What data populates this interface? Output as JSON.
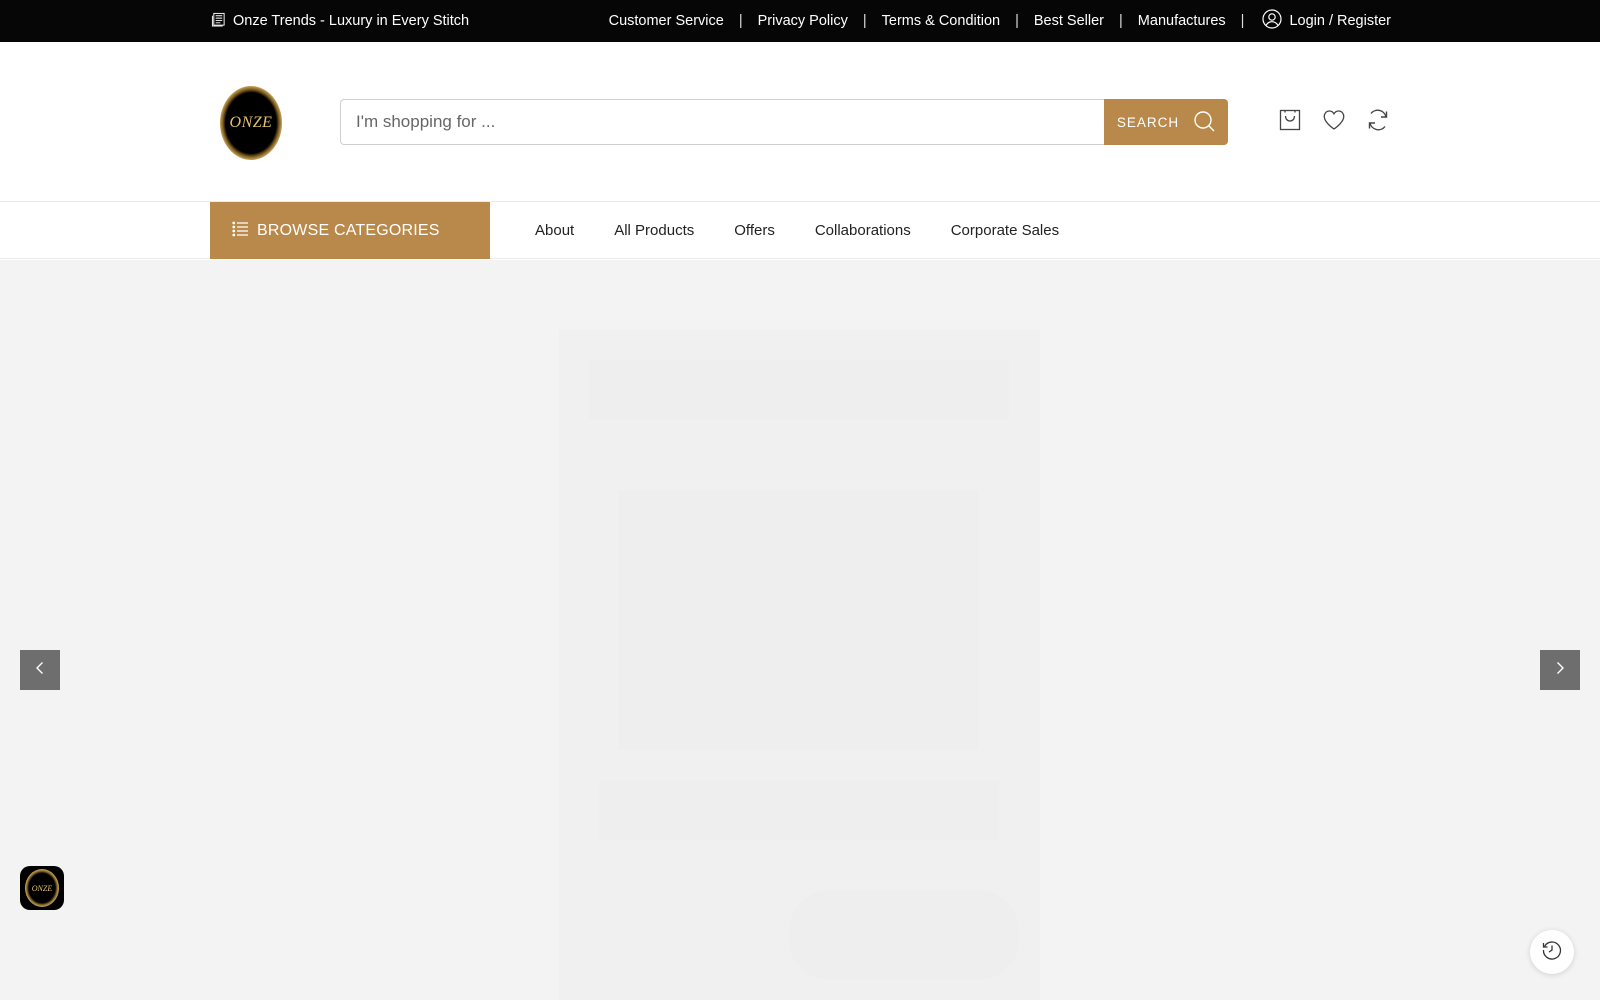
{
  "topbar": {
    "tagline": "Onze Trends - Luxury in Every Stitch",
    "links": [
      "Customer Service",
      "Privacy Policy",
      "Terms & Condition",
      "Best Seller",
      "Manufactures"
    ],
    "separator": "|",
    "login": "Login / Register"
  },
  "header": {
    "logo_text": "ONZE",
    "search": {
      "placeholder": "I'm shopping for ...",
      "value": "",
      "button_label": "SEARCH"
    },
    "icons": [
      "cart-icon",
      "heart-icon",
      "compare-icon"
    ]
  },
  "nav": {
    "browse_label": "BROWSE CATEGORIES",
    "items": [
      "About",
      "All Products",
      "Offers",
      "Collaborations",
      "Corporate Sales"
    ]
  },
  "floating": {
    "badge_text": "ONZE"
  },
  "colors": {
    "topbar_bg": "#060606",
    "accent": "#b8894a",
    "hero_bg": "#f4f3f3",
    "arrow_bg": "#6e6e6e"
  }
}
